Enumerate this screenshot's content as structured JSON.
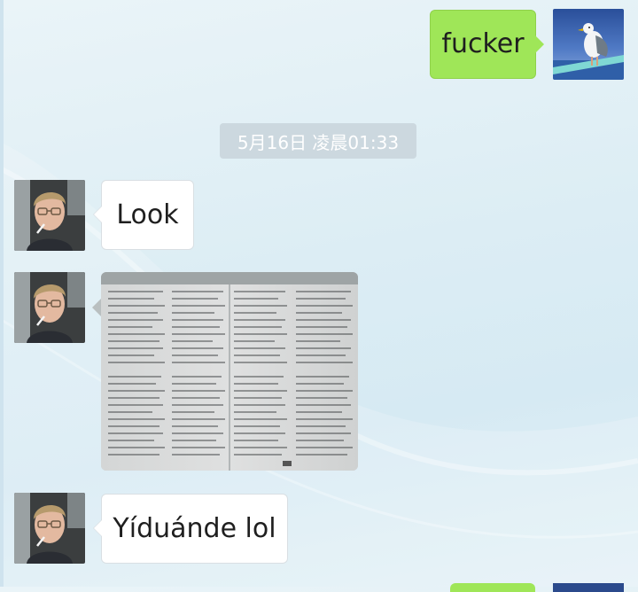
{
  "timestamp": "5月16日 凌晨01:33",
  "messages": [
    {
      "sender": "me",
      "type": "text",
      "text": "fucker",
      "avatar": "seagull-avatar"
    },
    {
      "sender": "contact",
      "type": "text",
      "text": "Look",
      "avatar": "contact-avatar"
    },
    {
      "sender": "contact",
      "type": "image",
      "image": "dictionary-page-photo",
      "avatar": "contact-avatar"
    },
    {
      "sender": "contact",
      "type": "text",
      "text": "Yíduánde lol",
      "avatar": "contact-avatar"
    }
  ],
  "colors": {
    "outgoing_bubble": "#9fe658",
    "incoming_bubble": "#ffffff",
    "timestamp_bg": "#c8d4da"
  }
}
